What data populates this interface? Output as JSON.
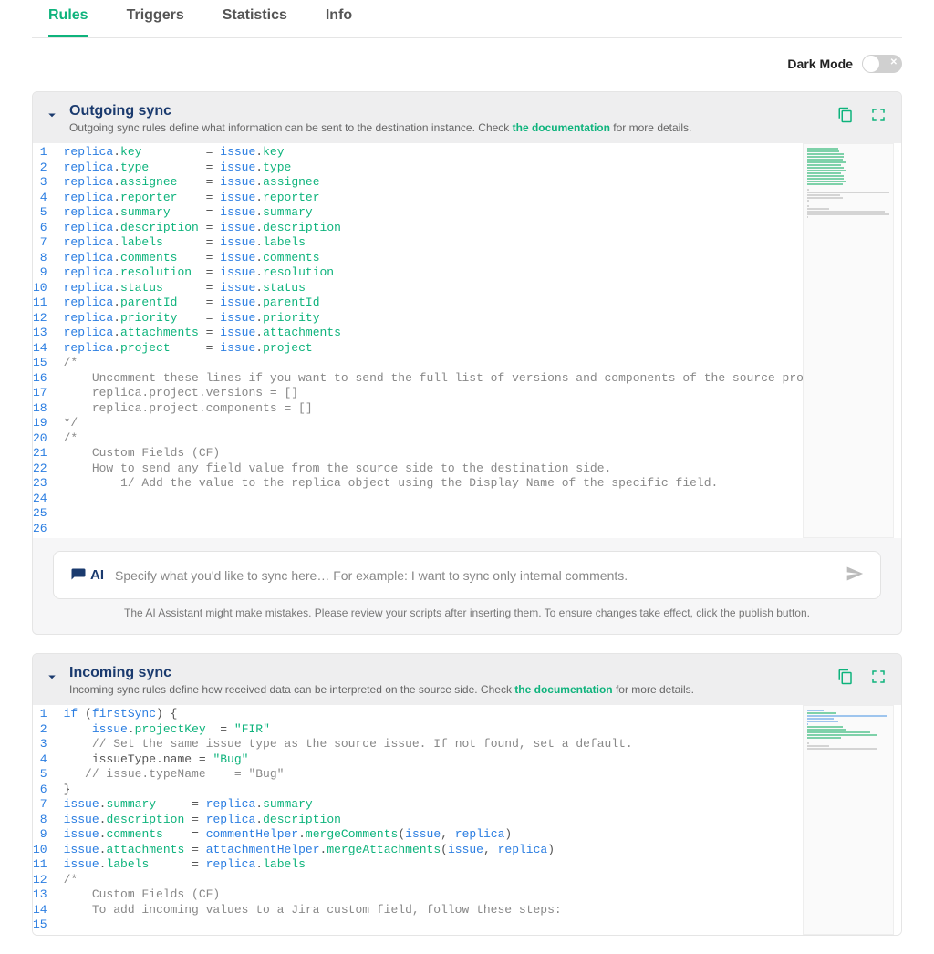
{
  "tabs": [
    "Rules",
    "Triggers",
    "Statistics",
    "Info"
  ],
  "active_tab": 0,
  "darkmode_label": "Dark Mode",
  "outgoing": {
    "title": "Outgoing sync",
    "desc_pre": "Outgoing sync rules define what information can be sent to the destination instance. Check ",
    "desc_link": "the documentation",
    "desc_post": " for more details.",
    "ai_label": "AI",
    "ai_placeholder": "Specify what you'd like to sync here…  For example: I want to sync only internal comments.",
    "ai_note": "The AI Assistant might make mistakes. Please review your scripts after inserting them. To ensure changes take effect, click the publish button.",
    "lines": [
      {
        "n": 1,
        "tokens": [
          [
            "obj",
            "replica"
          ],
          [
            "op",
            "."
          ],
          [
            "prop",
            "key"
          ],
          [
            "pad",
            "         "
          ],
          [
            "op",
            "= "
          ],
          [
            "obj",
            "issue"
          ],
          [
            "op",
            "."
          ],
          [
            "prop",
            "key"
          ]
        ]
      },
      {
        "n": 2,
        "tokens": [
          [
            "obj",
            "replica"
          ],
          [
            "op",
            "."
          ],
          [
            "prop",
            "type"
          ],
          [
            "pad",
            "        "
          ],
          [
            "op",
            "= "
          ],
          [
            "obj",
            "issue"
          ],
          [
            "op",
            "."
          ],
          [
            "prop",
            "type"
          ]
        ]
      },
      {
        "n": 3,
        "tokens": [
          [
            "obj",
            "replica"
          ],
          [
            "op",
            "."
          ],
          [
            "prop",
            "assignee"
          ],
          [
            "pad",
            "    "
          ],
          [
            "op",
            "= "
          ],
          [
            "obj",
            "issue"
          ],
          [
            "op",
            "."
          ],
          [
            "prop",
            "assignee"
          ]
        ]
      },
      {
        "n": 4,
        "tokens": [
          [
            "obj",
            "replica"
          ],
          [
            "op",
            "."
          ],
          [
            "prop",
            "reporter"
          ],
          [
            "pad",
            "    "
          ],
          [
            "op",
            "= "
          ],
          [
            "obj",
            "issue"
          ],
          [
            "op",
            "."
          ],
          [
            "prop",
            "reporter"
          ]
        ]
      },
      {
        "n": 5,
        "tokens": [
          [
            "obj",
            "replica"
          ],
          [
            "op",
            "."
          ],
          [
            "prop",
            "summary"
          ],
          [
            "pad",
            "     "
          ],
          [
            "op",
            "= "
          ],
          [
            "obj",
            "issue"
          ],
          [
            "op",
            "."
          ],
          [
            "prop",
            "summary"
          ]
        ]
      },
      {
        "n": 6,
        "tokens": [
          [
            "obj",
            "replica"
          ],
          [
            "op",
            "."
          ],
          [
            "prop",
            "description"
          ],
          [
            "pad",
            " "
          ],
          [
            "op",
            "= "
          ],
          [
            "obj",
            "issue"
          ],
          [
            "op",
            "."
          ],
          [
            "prop",
            "description"
          ]
        ]
      },
      {
        "n": 7,
        "tokens": [
          [
            "obj",
            "replica"
          ],
          [
            "op",
            "."
          ],
          [
            "prop",
            "labels"
          ],
          [
            "pad",
            "      "
          ],
          [
            "op",
            "= "
          ],
          [
            "obj",
            "issue"
          ],
          [
            "op",
            "."
          ],
          [
            "prop",
            "labels"
          ]
        ]
      },
      {
        "n": 8,
        "tokens": [
          [
            "obj",
            "replica"
          ],
          [
            "op",
            "."
          ],
          [
            "prop",
            "comments"
          ],
          [
            "pad",
            "    "
          ],
          [
            "op",
            "= "
          ],
          [
            "obj",
            "issue"
          ],
          [
            "op",
            "."
          ],
          [
            "prop",
            "comments"
          ]
        ]
      },
      {
        "n": 9,
        "tokens": [
          [
            "obj",
            "replica"
          ],
          [
            "op",
            "."
          ],
          [
            "prop",
            "resolution"
          ],
          [
            "pad",
            "  "
          ],
          [
            "op",
            "= "
          ],
          [
            "obj",
            "issue"
          ],
          [
            "op",
            "."
          ],
          [
            "prop",
            "resolution"
          ]
        ]
      },
      {
        "n": 10,
        "tokens": [
          [
            "obj",
            "replica"
          ],
          [
            "op",
            "."
          ],
          [
            "prop",
            "status"
          ],
          [
            "pad",
            "      "
          ],
          [
            "op",
            "= "
          ],
          [
            "obj",
            "issue"
          ],
          [
            "op",
            "."
          ],
          [
            "prop",
            "status"
          ]
        ]
      },
      {
        "n": 11,
        "tokens": [
          [
            "obj",
            "replica"
          ],
          [
            "op",
            "."
          ],
          [
            "prop",
            "parentId"
          ],
          [
            "pad",
            "    "
          ],
          [
            "op",
            "= "
          ],
          [
            "obj",
            "issue"
          ],
          [
            "op",
            "."
          ],
          [
            "prop",
            "parentId"
          ]
        ]
      },
      {
        "n": 12,
        "tokens": [
          [
            "obj",
            "replica"
          ],
          [
            "op",
            "."
          ],
          [
            "prop",
            "priority"
          ],
          [
            "pad",
            "    "
          ],
          [
            "op",
            "= "
          ],
          [
            "obj",
            "issue"
          ],
          [
            "op",
            "."
          ],
          [
            "prop",
            "priority"
          ]
        ]
      },
      {
        "n": 13,
        "tokens": [
          [
            "obj",
            "replica"
          ],
          [
            "op",
            "."
          ],
          [
            "prop",
            "attachments"
          ],
          [
            "pad",
            " "
          ],
          [
            "op",
            "= "
          ],
          [
            "obj",
            "issue"
          ],
          [
            "op",
            "."
          ],
          [
            "prop",
            "attachments"
          ]
        ]
      },
      {
        "n": 14,
        "tokens": [
          [
            "obj",
            "replica"
          ],
          [
            "op",
            "."
          ],
          [
            "prop",
            "project"
          ],
          [
            "pad",
            "     "
          ],
          [
            "op",
            "= "
          ],
          [
            "obj",
            "issue"
          ],
          [
            "op",
            "."
          ],
          [
            "prop",
            "project"
          ]
        ]
      },
      {
        "n": 15,
        "tokens": [
          [
            "",
            ""
          ]
        ]
      },
      {
        "n": 16,
        "tokens": [
          [
            "comment",
            "/*"
          ]
        ]
      },
      {
        "n": 17,
        "tokens": [
          [
            "comment",
            "    Uncomment these lines if you want to send the full list of versions and components of the source project."
          ]
        ]
      },
      {
        "n": 18,
        "tokens": [
          [
            "comment",
            "    replica.project.versions = []"
          ]
        ]
      },
      {
        "n": 19,
        "tokens": [
          [
            "comment",
            "    replica.project.components = []"
          ]
        ]
      },
      {
        "n": 20,
        "tokens": [
          [
            "comment",
            "*/"
          ]
        ]
      },
      {
        "n": 21,
        "tokens": [
          [
            "",
            ""
          ]
        ]
      },
      {
        "n": 22,
        "tokens": [
          [
            "comment",
            "/*"
          ]
        ]
      },
      {
        "n": 23,
        "tokens": [
          [
            "comment",
            "    Custom Fields (CF)"
          ]
        ]
      },
      {
        "n": 24,
        "tokens": [
          [
            "comment",
            "    How to send any field value from the source side to the destination side."
          ]
        ]
      },
      {
        "n": 25,
        "tokens": [
          [
            "comment",
            "        1/ Add the value to the replica object using the Display Name of the specific field."
          ]
        ]
      },
      {
        "n": 26,
        "tokens": [
          [
            "comment",
            " "
          ]
        ]
      }
    ]
  },
  "incoming": {
    "title": "Incoming sync",
    "desc_pre": "Incoming sync rules define how received data can be interpreted on the source side. Check ",
    "desc_link": "the documentation",
    "desc_post": " for more details.",
    "lines": [
      {
        "n": 1,
        "tokens": [
          [
            "kw",
            "if"
          ],
          [
            "op",
            " ("
          ],
          [
            "obj",
            "firstSync"
          ],
          [
            "op",
            ") {"
          ]
        ]
      },
      {
        "n": 2,
        "tokens": [
          [
            "op",
            "    "
          ],
          [
            "obj",
            "issue"
          ],
          [
            "op",
            "."
          ],
          [
            "prop",
            "projectKey"
          ],
          [
            "op",
            "  = "
          ],
          [
            "str",
            "\"FIR\""
          ]
        ]
      },
      {
        "n": 3,
        "tokens": [
          [
            "op",
            "    "
          ],
          [
            "comment",
            "// Set the same issue type as the source issue. If not found, set a default."
          ]
        ]
      },
      {
        "n": 4,
        "tokens": [
          [
            "op",
            "    "
          ],
          [
            "plain",
            "issueType.name = "
          ],
          [
            "str",
            "\"Bug\""
          ]
        ]
      },
      {
        "n": 5,
        "tokens": [
          [
            "op",
            "   "
          ],
          [
            "comment",
            "// issue.typeName    = \"Bug\""
          ]
        ]
      },
      {
        "n": 6,
        "tokens": [
          [
            "op",
            "}"
          ]
        ]
      },
      {
        "n": 7,
        "tokens": [
          [
            "obj",
            "issue"
          ],
          [
            "op",
            "."
          ],
          [
            "prop",
            "summary"
          ],
          [
            "pad",
            "     "
          ],
          [
            "op",
            "= "
          ],
          [
            "obj",
            "replica"
          ],
          [
            "op",
            "."
          ],
          [
            "prop",
            "summary"
          ]
        ]
      },
      {
        "n": 8,
        "tokens": [
          [
            "obj",
            "issue"
          ],
          [
            "op",
            "."
          ],
          [
            "prop",
            "description"
          ],
          [
            "pad",
            " "
          ],
          [
            "op",
            "= "
          ],
          [
            "obj",
            "replica"
          ],
          [
            "op",
            "."
          ],
          [
            "prop",
            "description"
          ]
        ]
      },
      {
        "n": 9,
        "tokens": [
          [
            "obj",
            "issue"
          ],
          [
            "op",
            "."
          ],
          [
            "prop",
            "comments"
          ],
          [
            "pad",
            "    "
          ],
          [
            "op",
            "= "
          ],
          [
            "obj",
            "commentHelper"
          ],
          [
            "op",
            "."
          ],
          [
            "fn",
            "mergeComments"
          ],
          [
            "op",
            "("
          ],
          [
            "obj",
            "issue"
          ],
          [
            "op",
            ", "
          ],
          [
            "obj",
            "replica"
          ],
          [
            "op",
            ")"
          ]
        ]
      },
      {
        "n": 10,
        "tokens": [
          [
            "obj",
            "issue"
          ],
          [
            "op",
            "."
          ],
          [
            "prop",
            "attachments"
          ],
          [
            "pad",
            " "
          ],
          [
            "op",
            "= "
          ],
          [
            "obj",
            "attachmentHelper"
          ],
          [
            "op",
            "."
          ],
          [
            "fn",
            "mergeAttachments"
          ],
          [
            "op",
            "("
          ],
          [
            "obj",
            "issue"
          ],
          [
            "op",
            ", "
          ],
          [
            "obj",
            "replica"
          ],
          [
            "op",
            ")"
          ]
        ]
      },
      {
        "n": 11,
        "tokens": [
          [
            "obj",
            "issue"
          ],
          [
            "op",
            "."
          ],
          [
            "prop",
            "labels"
          ],
          [
            "pad",
            "      "
          ],
          [
            "op",
            "= "
          ],
          [
            "obj",
            "replica"
          ],
          [
            "op",
            "."
          ],
          [
            "prop",
            "labels"
          ]
        ]
      },
      {
        "n": 12,
        "tokens": [
          [
            "",
            ""
          ]
        ]
      },
      {
        "n": 13,
        "tokens": [
          [
            "comment",
            "/*"
          ]
        ]
      },
      {
        "n": 14,
        "tokens": [
          [
            "comment",
            "    Custom Fields (CF)"
          ]
        ]
      },
      {
        "n": 15,
        "tokens": [
          [
            "comment",
            "    To add incoming values to a Jira custom field, follow these steps:"
          ]
        ]
      }
    ]
  }
}
